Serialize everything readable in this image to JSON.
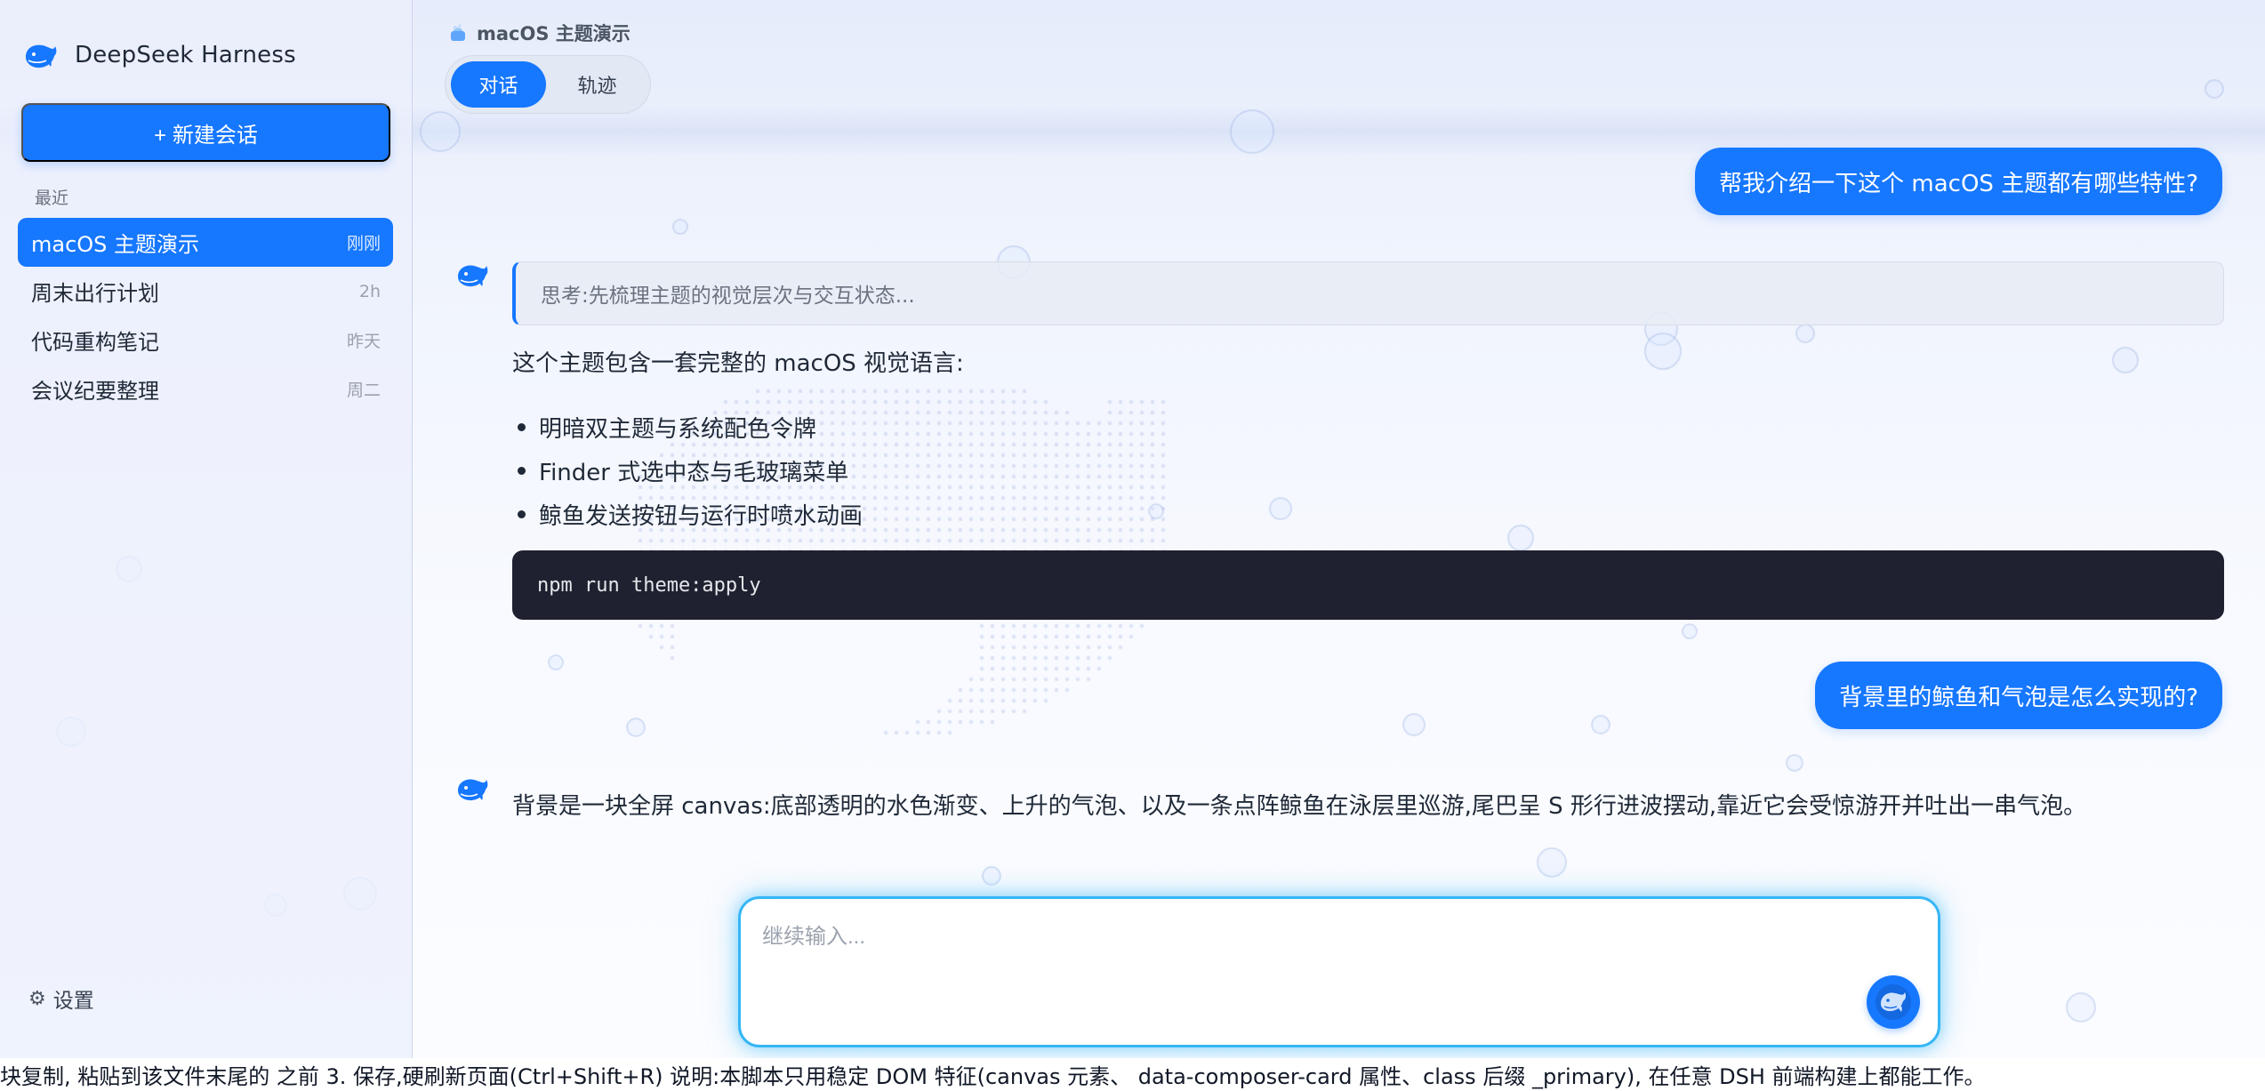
{
  "app": {
    "name": "DeepSeek Harness",
    "accent": "#1677ff",
    "icons": {
      "brand": "whale-icon",
      "send": "whale-send-icon",
      "settings": "gear-icon"
    }
  },
  "sidebar": {
    "new_chat_label": "+ 新建会话",
    "recent_label": "最近",
    "conversations": [
      {
        "title": "macOS 主题演示",
        "time": "刚刚",
        "active": true
      },
      {
        "title": "周末出行计划",
        "time": "2h",
        "active": false
      },
      {
        "title": "代码重构笔记",
        "time": "昨天",
        "active": false
      },
      {
        "title": "会议纪要整理",
        "time": "周二",
        "active": false
      }
    ],
    "settings_label": "设置"
  },
  "header": {
    "title": "macOS 主题演示",
    "tabs": [
      {
        "label": "对话",
        "active": true
      },
      {
        "label": "轨迹",
        "active": false
      }
    ]
  },
  "messages": {
    "user_1": "帮我介绍一下这个 macOS 主题都有哪些特性?",
    "thinking": "思考:先梳理主题的视觉层次与交互状态...",
    "assistant_1_intro": "这个主题包含一套完整的 macOS 视觉语言:",
    "assistant_1_bullets": [
      "明暗双主题与系统配色令牌",
      "Finder 式选中态与毛玻璃菜单",
      "鲸鱼发送按钮与运行时喷水动画"
    ],
    "assistant_1_code": "npm run theme:apply",
    "user_2": "背景里的鲸鱼和气泡是怎么实现的?",
    "assistant_2": "背景是一块全屏 canvas:底部透明的水色渐变、上升的气泡、以及一条点阵鲸鱼在泳层里巡游,尾巴呈 S 形行进波摆动,靠近它会受惊游开并吐出一串气泡。"
  },
  "composer": {
    "placeholder": "继续输入..."
  },
  "footer_text": "块复制, 粘贴到该文件末尾的 之前 3. 保存,硬刷新页面(Ctrl+Shift+R) 说明:本脚本只用稳定 DOM 特征(canvas 元素、 data-composer-card 属性、class 后缀 _primary), 在任意 DSH 前端构建上都能工作。"
}
